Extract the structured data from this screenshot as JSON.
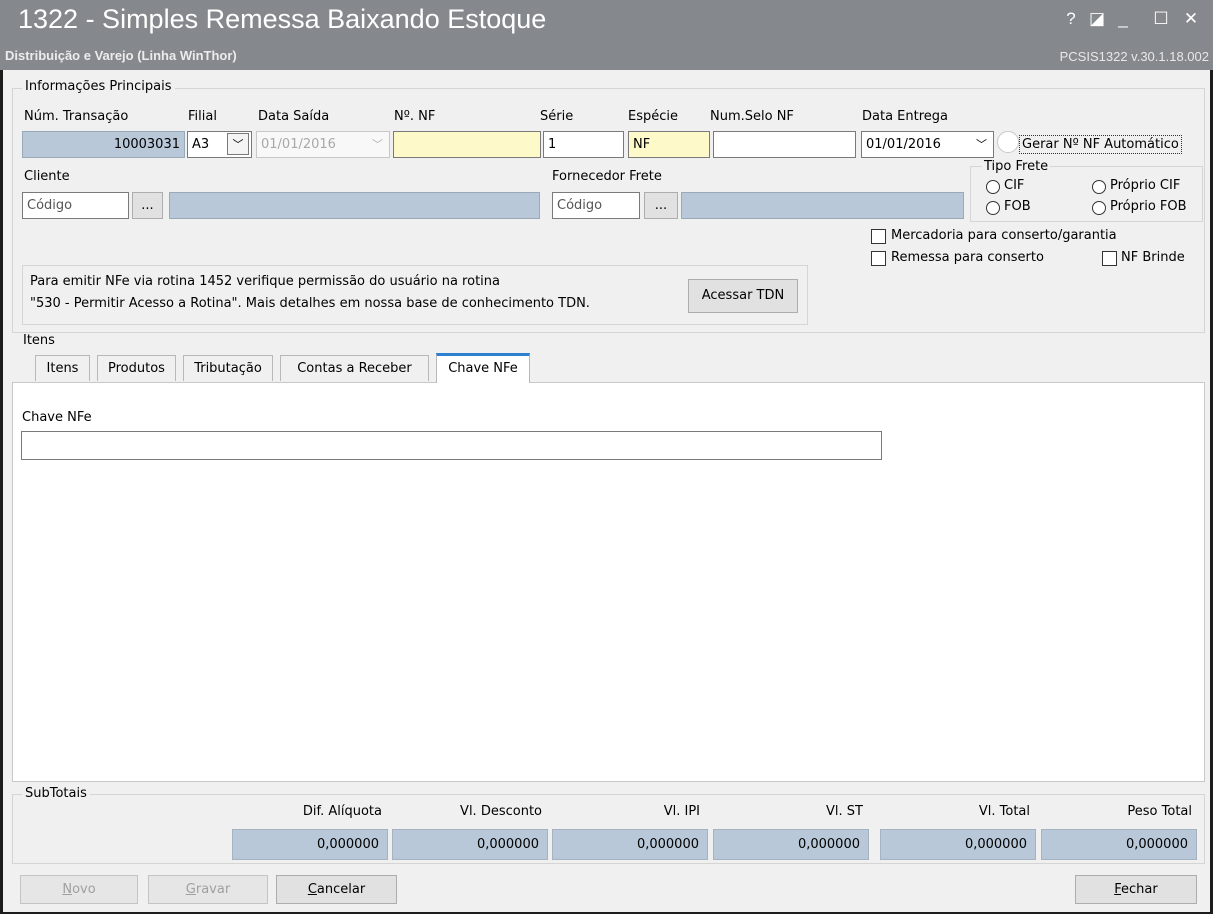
{
  "window": {
    "title": "1322 - Simples Remessa Baixando Estoque",
    "subtitle": "Distribuição e Varejo (Linha WinThor)",
    "version": "PCSIS1322  v.30.1.18.002",
    "controls": {
      "help": "?",
      "restore": "◪",
      "minimize": "_",
      "maximize": "☐",
      "close": "✕"
    }
  },
  "main_info": {
    "title": "Informações Principais",
    "num_transacao": {
      "label": "Núm. Transação",
      "value": "10003031"
    },
    "filial": {
      "label": "Filial",
      "value": "A3"
    },
    "data_saida": {
      "label": "Data Saída",
      "value": "01/01/2016"
    },
    "num_nf": {
      "label": "Nº. NF",
      "value": ""
    },
    "serie": {
      "label": "Série",
      "value": "1"
    },
    "especie": {
      "label": "Espécie",
      "value": "NF"
    },
    "num_selo": {
      "label": "Num.Selo NF",
      "value": ""
    },
    "data_entrega": {
      "label": "Data Entrega",
      "value": "01/01/2016"
    },
    "gerar_nf": "Gerar Nº NF Automático",
    "cliente": {
      "label": "Cliente",
      "code_value": "Código",
      "lookup": "...",
      "name_value": ""
    },
    "fornecedor": {
      "label": "Fornecedor Frete",
      "code_value": "Código",
      "lookup": "...",
      "name_value": ""
    },
    "tipo_frete": {
      "title": "Tipo Frete",
      "cif": "CIF",
      "fob": "FOB",
      "proprio_cif": "Próprio CIF",
      "proprio_fob": "Próprio FOB"
    },
    "checks": {
      "mercadoria": "Mercadoria para conserto/garantia",
      "remessa": "Remessa para conserto",
      "nf_brinde": "NF Brinde"
    },
    "notice": {
      "line1": "Para emitir NFe via rotina 1452 verifique permissão do usuário na rotina",
      "line2": "\"530 - Permitir Acesso a Rotina\". Mais detalhes em nossa base de conhecimento TDN.",
      "button": "Acessar TDN"
    }
  },
  "items": {
    "title": "Itens",
    "tabs": [
      "Itens",
      "Produtos",
      "Tributação",
      "Contas a Receber",
      "Chave NFe"
    ],
    "active_tab": "Chave NFe",
    "chave_label": "Chave NFe",
    "chave_value": ""
  },
  "subtotals": {
    "title": "SubTotais",
    "fields": [
      {
        "label": "Dif. Alíquota",
        "value": "0,000000"
      },
      {
        "label": "Vl. Desconto",
        "value": "0,000000"
      },
      {
        "label": "Vl. IPI",
        "value": "0,000000"
      },
      {
        "label": "Vl. ST",
        "value": "0,000000"
      },
      {
        "label": "Vl. Total",
        "value": "0,000000"
      },
      {
        "label": "Peso Total",
        "value": "0,000000"
      }
    ]
  },
  "footer": {
    "novo": {
      "first": "N",
      "rest": "ovo"
    },
    "gravar": {
      "first": "G",
      "rest": "ravar"
    },
    "cancelar": {
      "first": "C",
      "rest": "ancelar"
    },
    "fechar": {
      "first": "F",
      "rest": "echar"
    }
  },
  "colors": {
    "titlebar": "#85898d",
    "gray_field": "#b8c8d8",
    "yellow_field": "#fdf9c8",
    "tab_accent": "#2d7fd0"
  }
}
